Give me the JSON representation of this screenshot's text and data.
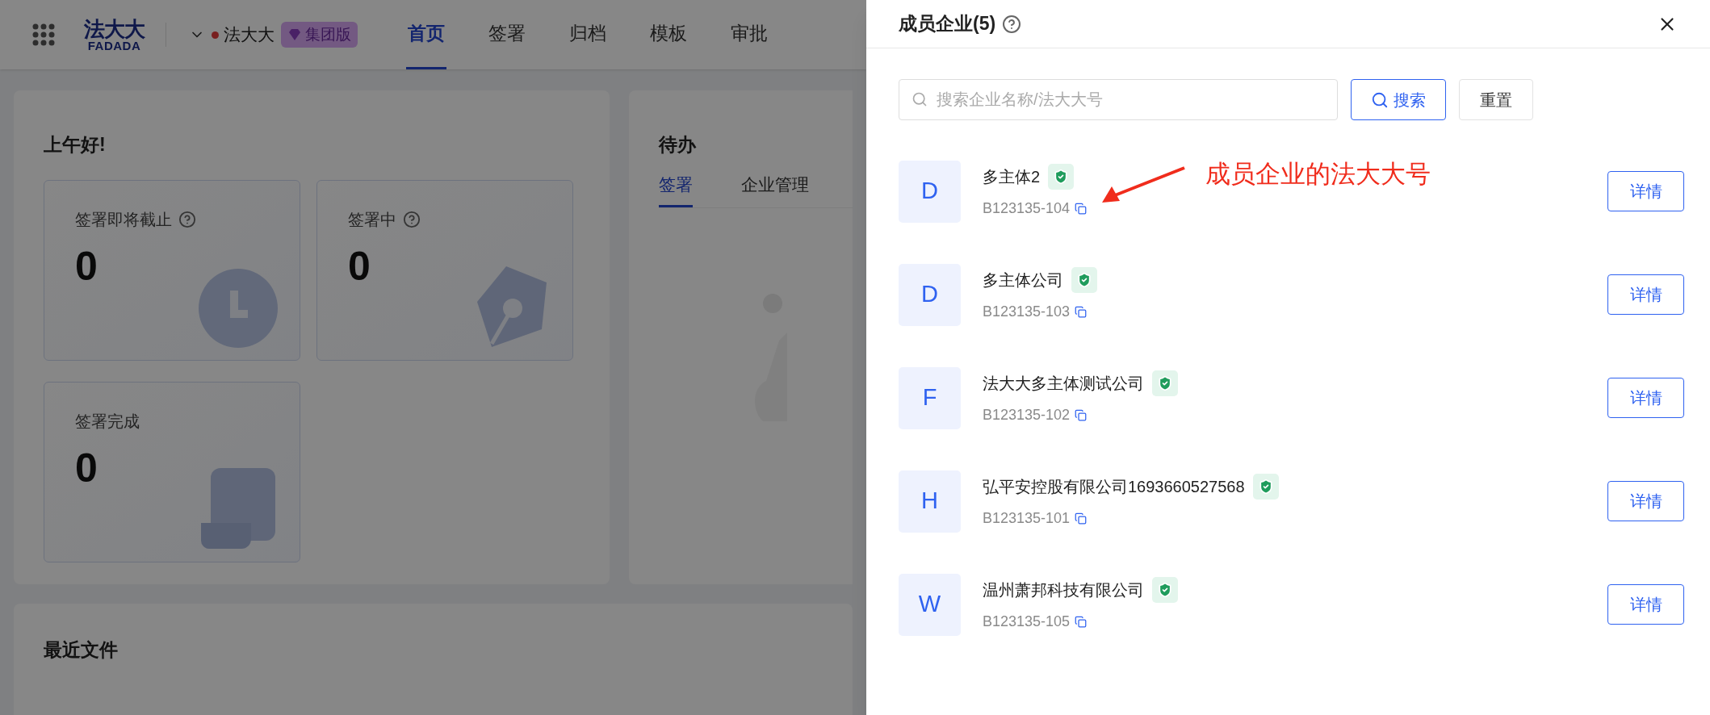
{
  "header": {
    "logo": {
      "top": "法大大",
      "bottom": "FADADA"
    },
    "org": {
      "name": "法大大",
      "badge": "集团版"
    },
    "nav": [
      {
        "label": "首页",
        "selected": true
      },
      {
        "label": "签署",
        "selected": false
      },
      {
        "label": "归档",
        "selected": false
      },
      {
        "label": "模板",
        "selected": false
      },
      {
        "label": "审批",
        "selected": false
      }
    ]
  },
  "greeting": {
    "title": "上午好!",
    "stats": [
      {
        "label": "签署即将截止",
        "value": "0",
        "help": true,
        "kind": "clock"
      },
      {
        "label": "签署中",
        "value": "0",
        "help": true,
        "kind": "pen"
      },
      {
        "label": "签署完成",
        "value": "0",
        "help": false,
        "kind": "scroll"
      }
    ]
  },
  "todo": {
    "title": "待办",
    "tabs": [
      {
        "label": "签署",
        "selected": true
      },
      {
        "label": "企业管理",
        "selected": false
      }
    ]
  },
  "recent": {
    "title": "最近文件"
  },
  "drawer": {
    "title": "成员企业(5)",
    "search": {
      "placeholder": "搜索企业名称/法大大号"
    },
    "search_button": "搜索",
    "reset_button": "重置",
    "members": [
      {
        "initial": "D",
        "name": "多主体2",
        "verified": true,
        "number": "B123135-104",
        "action": "详情"
      },
      {
        "initial": "D",
        "name": "多主体公司",
        "verified": true,
        "number": "B123135-103",
        "action": "详情"
      },
      {
        "initial": "F",
        "name": "法大大多主体测试公司",
        "verified": true,
        "number": "B123135-102",
        "action": "详情"
      },
      {
        "initial": "H",
        "name": "弘平安控股有限公司1693660527568",
        "verified": true,
        "number": "B123135-101",
        "action": "详情"
      },
      {
        "initial": "W",
        "name": "温州萧邦科技有限公司",
        "verified": true,
        "number": "B123135-105",
        "action": "详情"
      }
    ]
  },
  "annotation": {
    "text": "成员企业的法大大号"
  }
}
